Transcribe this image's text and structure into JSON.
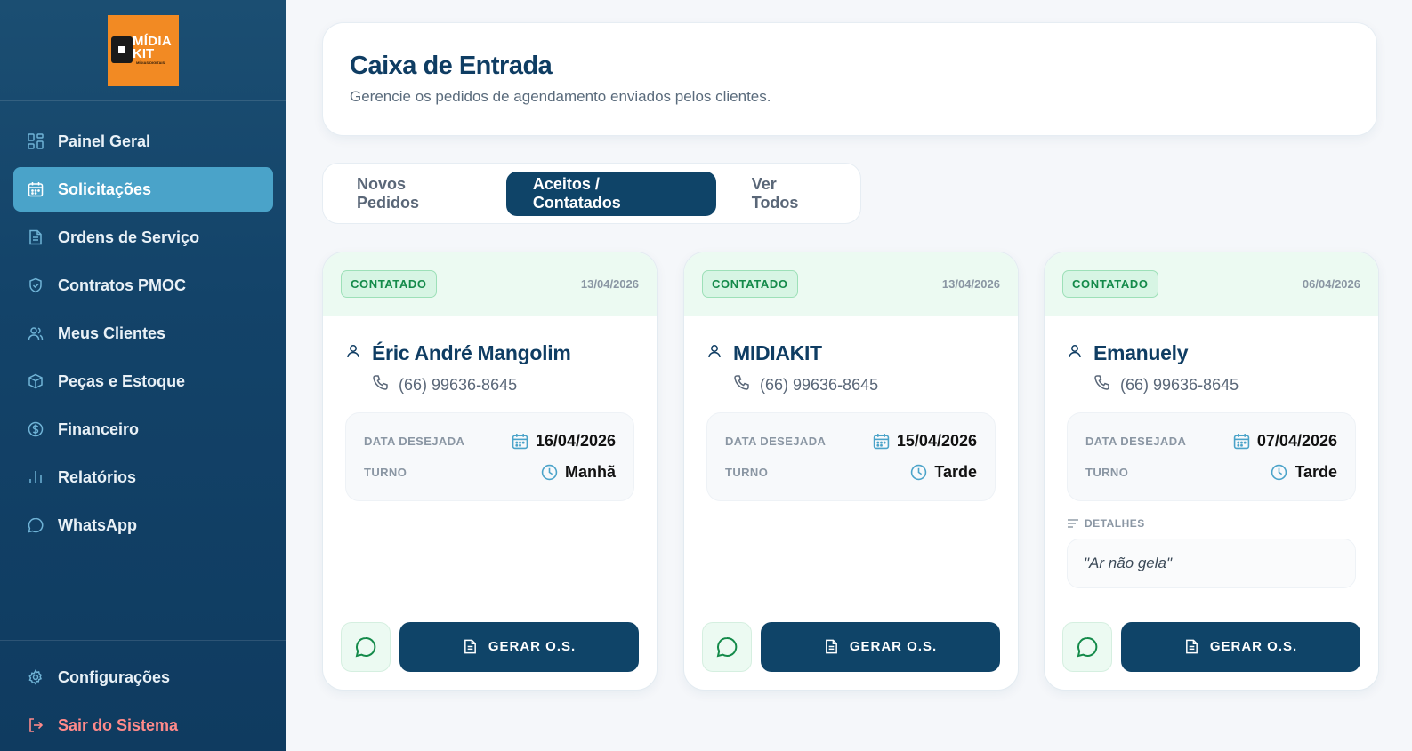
{
  "brand": {
    "logo_line1": "MÍDIA",
    "logo_line2": "KIT",
    "logo_sub": "MÍDIAS DIGITAIS",
    "logo_bg": "#f28a23"
  },
  "sidebar": {
    "items": [
      {
        "label": "Painel Geral",
        "icon": "dashboard-icon",
        "active": false
      },
      {
        "label": "Solicitações",
        "icon": "calendar-icon",
        "active": true
      },
      {
        "label": "Ordens de Serviço",
        "icon": "document-icon",
        "active": false
      },
      {
        "label": "Contratos PMOC",
        "icon": "shield-icon",
        "active": false
      },
      {
        "label": "Meus Clientes",
        "icon": "users-icon",
        "active": false
      },
      {
        "label": "Peças e Estoque",
        "icon": "box-icon",
        "active": false
      },
      {
        "label": "Financeiro",
        "icon": "dollar-icon",
        "active": false
      },
      {
        "label": "Relatórios",
        "icon": "bar-chart-icon",
        "active": false
      },
      {
        "label": "WhatsApp",
        "icon": "chat-bubble-icon",
        "active": false
      }
    ],
    "bottom": [
      {
        "label": "Configurações",
        "icon": "gear-icon"
      },
      {
        "label": "Sair do Sistema",
        "icon": "logout-icon"
      }
    ]
  },
  "header": {
    "title": "Caixa de Entrada",
    "subtitle": "Gerencie os pedidos de agendamento enviados pelos clientes."
  },
  "tabs": [
    {
      "label": "Novos Pedidos",
      "active": false
    },
    {
      "label": "Aceitos / Contatados",
      "active": true
    },
    {
      "label": "Ver Todos",
      "active": false
    }
  ],
  "labels": {
    "date_desired": "DATA DESEJADA",
    "shift": "TURNO",
    "details": "DETALHES",
    "generate_os": "GERAR O.S."
  },
  "cards": [
    {
      "status": "CONTATADO",
      "created": "13/04/2026",
      "name": "Éric André Mangolim",
      "phone": "(66) 99636-8645",
      "desired_date": "16/04/2026",
      "shift": "Manhã",
      "details": ""
    },
    {
      "status": "CONTATADO",
      "created": "13/04/2026",
      "name": "MIDIAKIT",
      "phone": "(66) 99636-8645",
      "desired_date": "15/04/2026",
      "shift": "Tarde",
      "details": ""
    },
    {
      "status": "CONTATADO",
      "created": "06/04/2026",
      "name": "Emanuely",
      "phone": "(66) 99636-8645",
      "desired_date": "07/04/2026",
      "shift": "Tarde",
      "details": "\"Ar não gela\""
    }
  ],
  "colors": {
    "primary": "#0f4468",
    "active_nav": "#4aa3c9",
    "success": "#148a4a",
    "danger": "#ff8a8a"
  }
}
